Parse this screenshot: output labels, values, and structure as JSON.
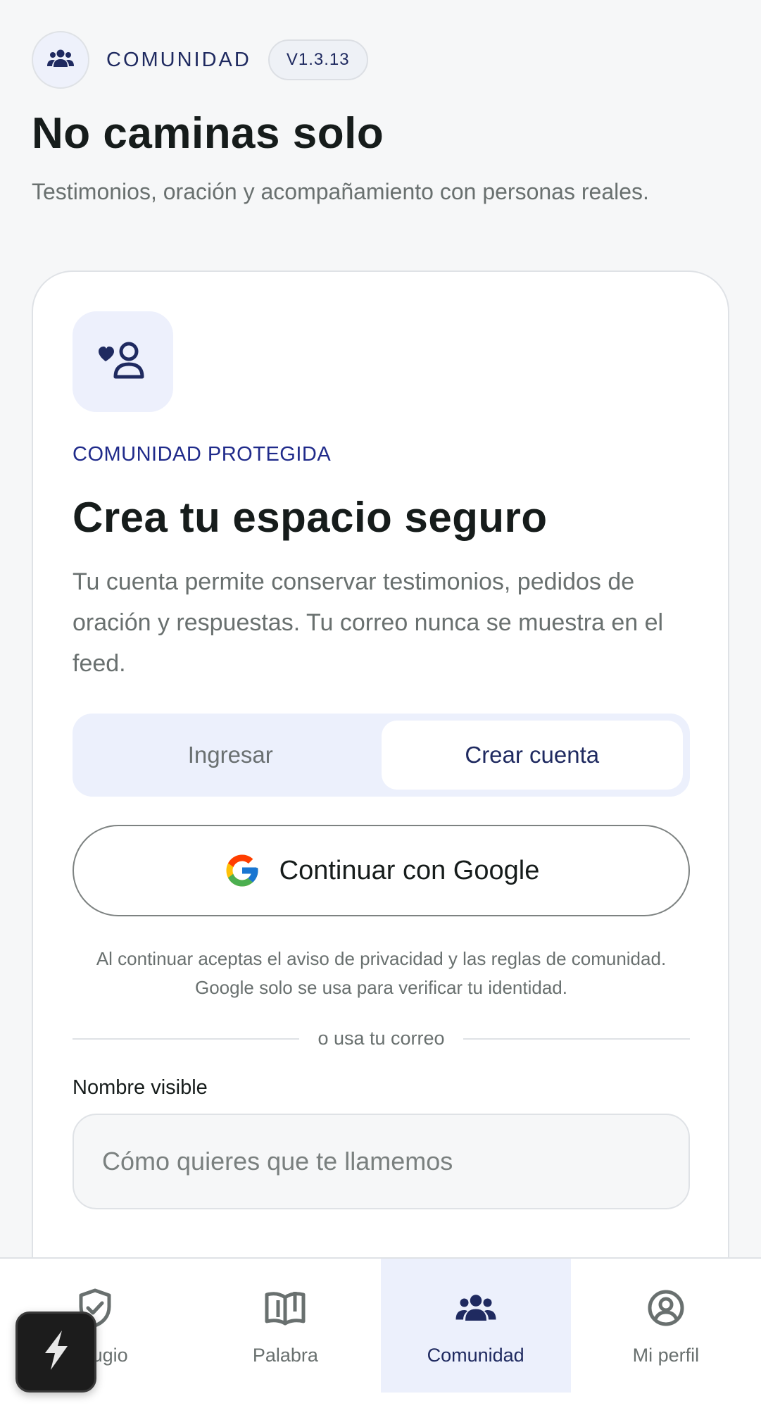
{
  "header": {
    "section_label": "COMUNIDAD",
    "version": "V1.3.13",
    "title": "No caminas solo",
    "subtitle": "Testimonios, oración y acompañamiento con personas reales."
  },
  "card": {
    "eyebrow": "COMUNIDAD PROTEGIDA",
    "title": "Crea tu espacio seguro",
    "description": "Tu cuenta permite conservar testimonios, pedidos de oración y respuestas. Tu correo nunca se muestra en el feed.",
    "tabs": [
      {
        "label": "Ingresar",
        "active": false
      },
      {
        "label": "Crear cuenta",
        "active": true
      }
    ],
    "google_button": "Continuar con Google",
    "legal": "Al continuar aceptas el aviso de privacidad y las reglas de comunidad. Google solo se usa para verificar tu identidad.",
    "divider": "o usa tu correo",
    "name_field": {
      "label": "Nombre visible",
      "placeholder": "Cómo quieres que te llamemos",
      "value": ""
    }
  },
  "nav": {
    "items": [
      {
        "label": "Refugio",
        "icon": "shield-check-icon",
        "active": false
      },
      {
        "label": "Palabra",
        "icon": "open-book-icon",
        "active": false
      },
      {
        "label": "Comunidad",
        "icon": "people-group-icon",
        "active": true
      },
      {
        "label": "Mi perfil",
        "icon": "user-circle-icon",
        "active": false
      }
    ]
  },
  "fab": {
    "icon": "lightning-icon"
  },
  "colors": {
    "accent": "#1f2a60",
    "accent_soft": "#ecf0fc",
    "text_primary": "#161c1b",
    "text_muted": "#69706f"
  }
}
